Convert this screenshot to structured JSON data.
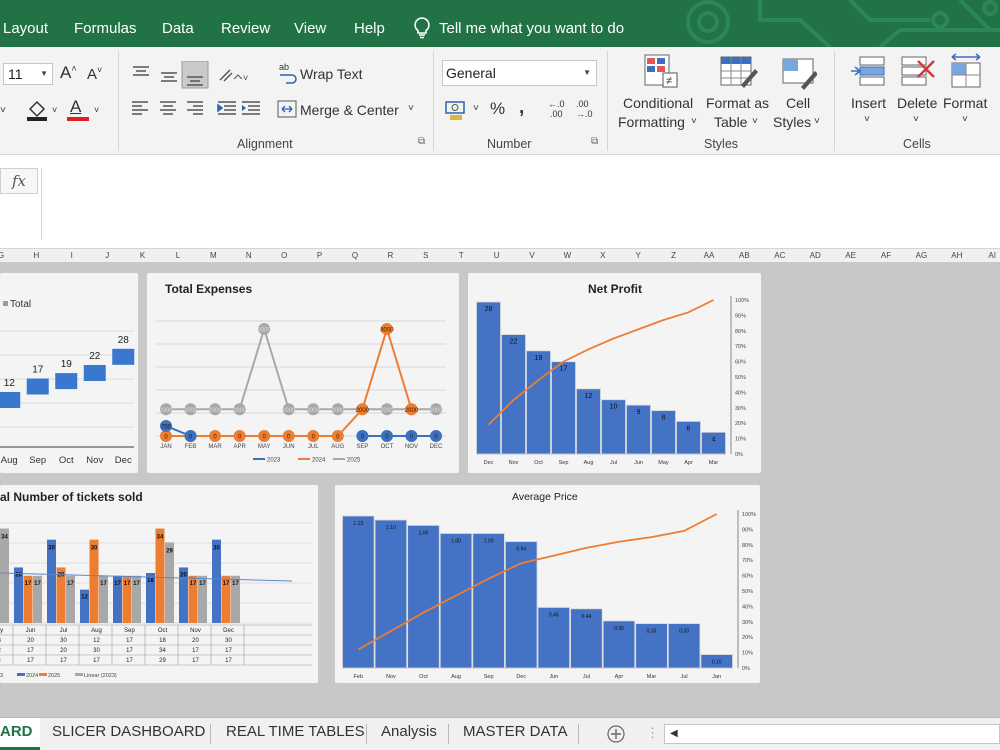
{
  "menu": [
    "Layout",
    "Formulas",
    "Data",
    "Review",
    "View",
    "Help"
  ],
  "tell_me": "Tell me what you want to do",
  "ribbon": {
    "font_size": "11",
    "wrap_text": "Wrap Text",
    "merge_center": "Merge & Center",
    "number_format": "General",
    "conditional": [
      "Conditional",
      "Formatting"
    ],
    "format_table": [
      "Format as",
      "Table"
    ],
    "cell_styles": [
      "Cell",
      "Styles"
    ],
    "insert": "Insert",
    "delete": "Delete",
    "format": "Format",
    "groups": {
      "alignment": "Alignment",
      "number": "Number",
      "styles": "Styles",
      "cells": "Cells"
    }
  },
  "formula": {
    "fx": "fx"
  },
  "columns": [
    "G",
    "H",
    "I",
    "J",
    "K",
    "L",
    "M",
    "N",
    "O",
    "P",
    "Q",
    "R",
    "S",
    "T",
    "U",
    "V",
    "W",
    "X",
    "Y",
    "Z",
    "AA",
    "AB",
    "AC",
    "AD",
    "AE",
    "AF",
    "AG",
    "AH",
    "AI"
  ],
  "tabs": [
    "ARD",
    "SLICER DASHBOARD",
    "REAL TIME TABLES",
    "Analysis",
    "MASTER DATA"
  ],
  "chart_data": [
    {
      "type": "bar",
      "title": "",
      "legend": [
        "Total"
      ],
      "categories": [
        "Aug",
        "Sep",
        "Oct",
        "Nov",
        "Dec"
      ],
      "values": [
        12,
        17,
        19,
        22,
        28
      ],
      "value_labels": [
        "12",
        "17",
        "19",
        "22",
        "28"
      ]
    },
    {
      "type": "line",
      "title": "Total Expenses",
      "legend": [
        "2023",
        "2024",
        "2025"
      ],
      "categories": [
        "JAN",
        "FEB",
        "MAR",
        "APR",
        "MAY",
        "JUN",
        "JUL",
        "AUG",
        "SEP",
        "OCT",
        "NOV",
        "DEC"
      ],
      "series": [
        {
          "name": "2023",
          "values": [
            750,
            0,
            null,
            null,
            null,
            null,
            null,
            null,
            0,
            0,
            0,
            0
          ],
          "labels": [
            "750",
            "0",
            "",
            "",
            "",
            "",
            "",
            "",
            "0",
            "0",
            "0",
            "0"
          ]
        },
        {
          "name": "2024",
          "values": [
            0,
            0,
            0,
            0,
            0,
            0,
            0,
            0,
            2000,
            8000,
            2000,
            null
          ],
          "labels": [
            "0",
            "0",
            "0",
            "0",
            "0",
            "0",
            "0",
            "0",
            "2000",
            "8000",
            "2000",
            ""
          ]
        },
        {
          "name": "2025",
          "values": [
            2000,
            2000,
            2000,
            2000,
            8000,
            2000,
            2000,
            2000,
            2000,
            2000,
            2000,
            2000
          ],
          "labels": [
            "2000",
            "2000",
            "2000",
            "2000",
            "8000",
            "2000",
            "2000",
            "2000",
            "2000",
            "2000",
            "2000",
            "2000"
          ]
        }
      ]
    },
    {
      "type": "bar",
      "title": "Net Profit",
      "categories": [
        "Dec",
        "Nov",
        "Oct",
        "Sep",
        "Aug",
        "Jul",
        "Jun",
        "May",
        "Apr",
        "Mar"
      ],
      "values": [
        28,
        22,
        19,
        17,
        12,
        10,
        9,
        8,
        6,
        4
      ],
      "value_labels": [
        "28",
        "22",
        "19",
        "17",
        "12",
        "10",
        "9",
        "8",
        "6",
        "4"
      ],
      "y2_ticks": [
        "0%",
        "10%",
        "20%",
        "30%",
        "40%",
        "50%",
        "60%",
        "70%",
        "80%",
        "90%",
        "100%"
      ],
      "cumulative": [
        0.19,
        0.35,
        0.48,
        0.6,
        0.68,
        0.75,
        0.81,
        0.87,
        0.92,
        1.0
      ]
    },
    {
      "type": "bar",
      "title": "al Number of tickets sold",
      "legend": [
        "2023",
        "2024",
        "2025",
        "Linear (2023)"
      ],
      "categories": [
        "May",
        "Jun",
        "Jul",
        "Aug",
        "Sep",
        "Oct",
        "Nov",
        "Dec"
      ],
      "series": [
        {
          "name": "2023",
          "values": [
            20,
            20,
            30,
            12,
            17,
            18,
            20,
            30
          ]
        },
        {
          "name": "2024",
          "values": [
            12,
            17,
            20,
            30,
            17,
            34,
            17,
            17
          ]
        },
        {
          "name": "2025",
          "values": [
            34,
            17,
            17,
            17,
            17,
            29,
            17,
            17
          ]
        }
      ],
      "value_labels": [
        [
          "",
          "20",
          "30",
          "12",
          "17",
          "18",
          "20",
          "30"
        ],
        [
          "12",
          "17",
          "20",
          "30",
          "17",
          "34",
          "17",
          "17"
        ],
        [
          "34",
          "17",
          "17",
          "17",
          "17",
          "29",
          "17",
          "17"
        ]
      ],
      "table": [
        [
          "May",
          "Jun",
          "Jul",
          "Aug",
          "Sep",
          "Oct",
          "Nov",
          "Dec"
        ],
        [
          "18",
          "20",
          "30",
          "12",
          "17",
          "18",
          "20",
          "30"
        ],
        [
          "12",
          "17",
          "20",
          "30",
          "17",
          "34",
          "17",
          "17"
        ],
        [
          "34",
          "17",
          "17",
          "17",
          "17",
          "29",
          "17",
          "17"
        ]
      ],
      "first_col": [
        "",
        "",
        "",
        ""
      ],
      "legend_row": [
        "3",
        "2024",
        "2025",
        "Linear (2023)"
      ]
    },
    {
      "type": "bar",
      "title": "Average Price",
      "categories": [
        "Feb",
        "Nov",
        "Oct",
        "Aug",
        "Sep",
        "Dec",
        "Jun",
        "Jul",
        "Apr",
        "Mar",
        "Jul",
        "Jan"
      ],
      "values": [
        1.13,
        1.1,
        1.06,
        1.0,
        1.0,
        0.94,
        0.45,
        0.44,
        0.35,
        0.33,
        0.33,
        0.1
      ],
      "value_labels": [
        "1.13",
        "1.10",
        "1.06",
        "1.00",
        "1.00",
        "0.94",
        "0.45",
        "0.44",
        "0.35",
        "0.33",
        "0.33",
        "0.10"
      ],
      "y2_ticks": [
        "0%",
        "10%",
        "20%",
        "30%",
        "40%",
        "50%",
        "60%",
        "70%",
        "80%",
        "90%",
        "100%"
      ],
      "cumulative": [
        0.12,
        0.24,
        0.36,
        0.47,
        0.58,
        0.68,
        0.73,
        0.78,
        0.82,
        0.85,
        0.89,
        1.0
      ]
    }
  ]
}
